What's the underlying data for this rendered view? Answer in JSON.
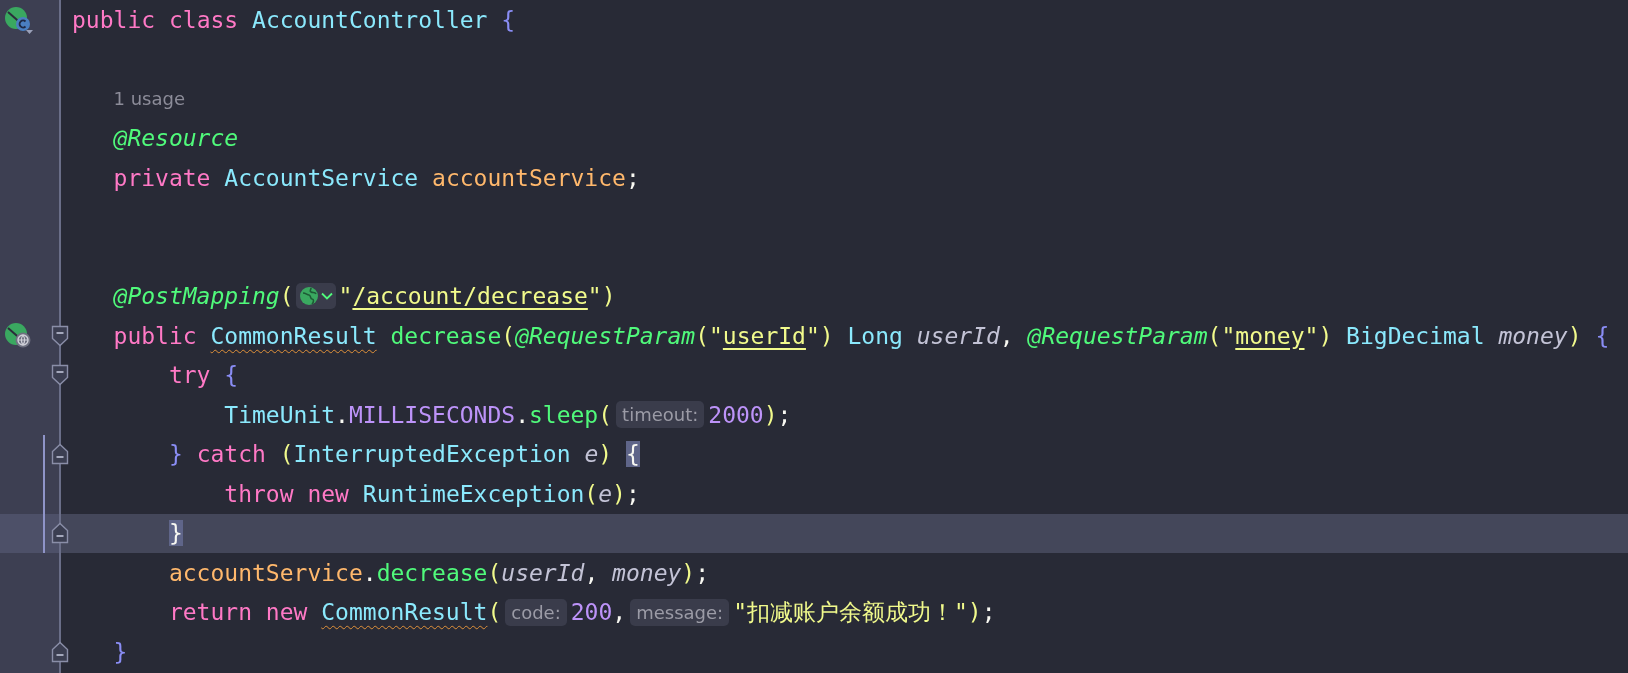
{
  "editor": {
    "lines": [
      {
        "gutter_icon": {
          "kind": "class"
        },
        "current": false,
        "changed": false,
        "tokens": [
          {
            "kind": "kw",
            "text": "public"
          },
          {
            "kind": "kw",
            "text": "class",
            "space_before": true
          },
          {
            "kind": "type",
            "text": "AccountController",
            "space_before": true
          },
          {
            "kind": "brace",
            "text": "{",
            "space_before": true
          }
        ],
        "children": [
          {
            "current": false,
            "changed": false
          },
          {
            "current": false,
            "changed": false,
            "tokens": [
              {
                "kind": "usage",
                "text": "1 usage"
              }
            ]
          },
          {
            "current": false,
            "changed": false,
            "tokens": [
              {
                "kind": "ann",
                "text": "@Resource"
              }
            ]
          },
          {
            "current": false,
            "changed": false,
            "tokens": [
              {
                "kind": "kw",
                "text": "private"
              },
              {
                "kind": "type",
                "text": "AccountService",
                "space_before": true
              },
              {
                "kind": "field",
                "text": "accountService",
                "space_before": true
              },
              {
                "kind": "punc",
                "text": ";"
              }
            ]
          },
          {
            "current": false,
            "changed": false
          },
          {
            "current": false,
            "changed": false
          },
          {
            "current": false,
            "changed": false,
            "tokens": [
              {
                "kind": "ann",
                "text": "@PostMapping"
              },
              {
                "kind": "paren",
                "text": "("
              },
              {
                "kind": "inlay"
              },
              {
                "kind": "str",
                "text": "\""
              },
              {
                "kind": "str",
                "text": "/account/decrease",
                "link": true
              },
              {
                "kind": "str",
                "text": "\""
              },
              {
                "kind": "paren",
                "text": ")"
              }
            ]
          },
          {
            "gutter_icon": {
              "kind": "endpoint"
            },
            "fold": {
              "kind": "open"
            },
            "current": false,
            "changed": false,
            "tokens": [
              {
                "kind": "kw",
                "text": "public"
              },
              {
                "kind": "type",
                "text": "CommonResult",
                "space_before": true,
                "warn": true
              },
              {
                "kind": "method",
                "text": "decrease",
                "space_before": true
              },
              {
                "kind": "paren",
                "text": "("
              },
              {
                "kind": "ann",
                "text": "@RequestParam"
              },
              {
                "kind": "paren",
                "text": "("
              },
              {
                "kind": "str",
                "text": "\""
              },
              {
                "kind": "str",
                "text": "userId",
                "link": true
              },
              {
                "kind": "str",
                "text": "\""
              },
              {
                "kind": "paren",
                "text": ")"
              },
              {
                "kind": "type",
                "text": "Long",
                "space_before": true
              },
              {
                "kind": "param",
                "text": "userId",
                "space_before": true
              },
              {
                "kind": "punc",
                "text": ","
              },
              {
                "kind": "ann",
                "text": "@RequestParam",
                "space_before": true
              },
              {
                "kind": "paren",
                "text": "("
              },
              {
                "kind": "str",
                "text": "\""
              },
              {
                "kind": "str",
                "text": "money",
                "link": true
              },
              {
                "kind": "str",
                "text": "\""
              },
              {
                "kind": "paren",
                "text": ")"
              },
              {
                "kind": "type",
                "text": "BigDecimal",
                "space_before": true
              },
              {
                "kind": "param",
                "text": "money",
                "space_before": true
              },
              {
                "kind": "paren",
                "text": ")"
              },
              {
                "kind": "brace",
                "text": "{",
                "space_before": true
              }
            ],
            "children": [
              {
                "fold": {
                  "kind": "open"
                },
                "current": false,
                "changed": false,
                "tokens": [
                  {
                    "kind": "kw",
                    "text": "try"
                  },
                  {
                    "kind": "brace",
                    "text": "{",
                    "space_before": true
                  }
                ],
                "children": [
                  {
                    "current": false,
                    "changed": false,
                    "tokens": [
                      {
                        "kind": "type",
                        "text": "TimeUnit"
                      },
                      {
                        "kind": "punc",
                        "text": "."
                      },
                      {
                        "kind": "const",
                        "text": "MILLISECONDS"
                      },
                      {
                        "kind": "punc",
                        "text": "."
                      },
                      {
                        "kind": "method",
                        "text": "sleep"
                      },
                      {
                        "kind": "paren",
                        "text": "("
                      },
                      {
                        "kind": "hint",
                        "text": "timeout:"
                      },
                      {
                        "kind": "num",
                        "text": "2000"
                      },
                      {
                        "kind": "paren",
                        "text": ")"
                      },
                      {
                        "kind": "punc",
                        "text": ";"
                      }
                    ]
                  }
                ]
              },
              {
                "fold": {
                  "kind": "close"
                },
                "current": false,
                "changed": true,
                "tokens": [
                  {
                    "kind": "brace",
                    "text": "}"
                  },
                  {
                    "kind": "kw",
                    "text": "catch",
                    "space_before": true
                  },
                  {
                    "kind": "paren",
                    "text": "(",
                    "space_before": true
                  },
                  {
                    "kind": "type",
                    "text": "InterruptedException"
                  },
                  {
                    "kind": "param",
                    "text": "e",
                    "space_before": true
                  },
                  {
                    "kind": "paren",
                    "text": ")"
                  },
                  {
                    "kind": "brace",
                    "text": "{",
                    "space_before": true,
                    "matched": true
                  }
                ],
                "children": [
                  {
                    "current": false,
                    "changed": true,
                    "tokens": [
                      {
                        "kind": "kw",
                        "text": "throw"
                      },
                      {
                        "kind": "kw",
                        "text": "new",
                        "space_before": true
                      },
                      {
                        "kind": "type",
                        "text": "RuntimeException",
                        "space_before": true
                      },
                      {
                        "kind": "paren",
                        "text": "("
                      },
                      {
                        "kind": "param",
                        "text": "e"
                      },
                      {
                        "kind": "paren",
                        "text": ")"
                      },
                      {
                        "kind": "punc",
                        "text": ";"
                      }
                    ]
                  }
                ]
              },
              {
                "fold": {
                  "kind": "close"
                },
                "current": true,
                "changed": true,
                "tokens": [
                  {
                    "kind": "brace",
                    "text": "}",
                    "matched": true
                  }
                ]
              },
              {
                "current": false,
                "changed": false,
                "tokens": [
                  {
                    "kind": "field",
                    "text": "accountService"
                  },
                  {
                    "kind": "punc",
                    "text": "."
                  },
                  {
                    "kind": "method",
                    "text": "decrease"
                  },
                  {
                    "kind": "paren",
                    "text": "("
                  },
                  {
                    "kind": "param",
                    "text": "userId"
                  },
                  {
                    "kind": "punc",
                    "text": ","
                  },
                  {
                    "kind": "param",
                    "text": "money",
                    "space_before": true
                  },
                  {
                    "kind": "paren",
                    "text": ")"
                  },
                  {
                    "kind": "punc",
                    "text": ";"
                  }
                ]
              },
              {
                "current": false,
                "changed": false,
                "tokens": [
                  {
                    "kind": "kw",
                    "text": "return"
                  },
                  {
                    "kind": "kw",
                    "text": "new",
                    "space_before": true
                  },
                  {
                    "kind": "type",
                    "text": "CommonResult",
                    "space_before": true,
                    "warn": true
                  },
                  {
                    "kind": "paren",
                    "text": "("
                  },
                  {
                    "kind": "hint",
                    "text": "code:"
                  },
                  {
                    "kind": "num",
                    "text": "200"
                  },
                  {
                    "kind": "punc",
                    "text": ","
                  },
                  {
                    "kind": "hint",
                    "text": "message:",
                    "space_before": true
                  },
                  {
                    "kind": "str",
                    "text": "\"扣减账户余额成功！\""
                  },
                  {
                    "kind": "paren",
                    "text": ")"
                  },
                  {
                    "kind": "punc",
                    "text": ";"
                  }
                ]
              }
            ]
          },
          {
            "fold": {
              "kind": "close"
            },
            "current": false,
            "changed": false,
            "tokens": [
              {
                "kind": "brace",
                "text": "}"
              }
            ]
          }
        ]
      }
    ]
  }
}
